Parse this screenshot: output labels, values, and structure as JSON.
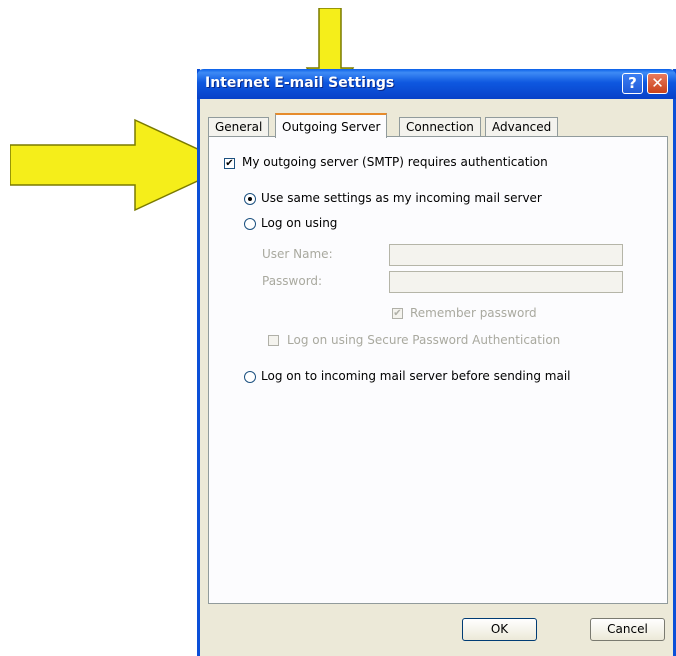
{
  "dialog": {
    "title": "Internet E-mail Settings",
    "help_label": "?",
    "close_label": "✕"
  },
  "tabs": [
    {
      "label": "General",
      "active": false
    },
    {
      "label": "Outgoing Server",
      "active": true
    },
    {
      "label": "Connection",
      "active": false
    },
    {
      "label": "Advanced",
      "active": false
    }
  ],
  "outgoing": {
    "smtp_auth_label": "My outgoing server (SMTP) requires authentication",
    "smtp_auth_checked": true,
    "same_settings_label": "Use same settings as my incoming mail server",
    "same_settings_selected": true,
    "log_on_using_label": "Log on using",
    "user_name_label": "User Name:",
    "user_name_value": "",
    "password_label": "Password:",
    "password_value": "",
    "remember_password_label": "Remember password",
    "remember_password_checked": true,
    "spa_label": "Log on using Secure Password Authentication",
    "spa_checked": false,
    "log_on_incoming_label": "Log on to incoming mail server before sending mail"
  },
  "buttons": {
    "ok_label": "OK",
    "cancel_label": "Cancel"
  },
  "colors": {
    "annotation_arrow": "#f5ee1a",
    "titlebar": "#0841c8",
    "dialog_face": "#ece9d8"
  }
}
